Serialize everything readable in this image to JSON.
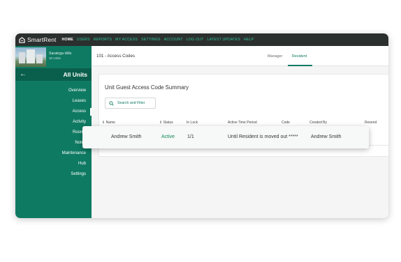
{
  "app": {
    "brand": "SmartRent"
  },
  "topnav": {
    "items": [
      {
        "label": "HOME",
        "active": true
      },
      {
        "label": "USERS"
      },
      {
        "label": "REPORTS"
      },
      {
        "label": "MY ACCESS"
      },
      {
        "label": "SETTINGS"
      },
      {
        "label": "ACCOUNT"
      },
      {
        "label": "LOG OUT"
      },
      {
        "label": "LATEST UPDATES"
      },
      {
        "label": "HELP"
      }
    ]
  },
  "colors": {
    "brand_green": "#0f7a62",
    "nav_active": "#ffffff",
    "nav_link": "#2fc79b",
    "status_active": "#0f8a55"
  },
  "property": {
    "name": "Saratoga Hills",
    "units": "10 Units"
  },
  "sidebar": {
    "title": "All Units",
    "back_icon": "arrow-left-icon",
    "items": [
      {
        "label": "Overview"
      },
      {
        "label": "Leases"
      },
      {
        "label": "Access",
        "active": true
      },
      {
        "label": "Activity"
      },
      {
        "label": "Rooms"
      },
      {
        "label": "Notes"
      },
      {
        "label": "Maintenance"
      },
      {
        "label": "Hub"
      },
      {
        "label": "Settings"
      }
    ]
  },
  "subheader": {
    "unit_title": "101 - Access Codes",
    "tabs": [
      {
        "label": "Manager"
      },
      {
        "label": "Resident",
        "active": true
      }
    ]
  },
  "summary": {
    "title": "Unit Guest Access Code Summary",
    "search_placeholder": "Search and Filter",
    "search_icon": "search-icon",
    "columns": [
      "Name",
      "Status",
      "In Lock",
      "Active Time Period",
      "Code",
      "Created By",
      "Resend"
    ],
    "rows": [
      {
        "name": "Andrew Smith",
        "status": "Active",
        "in_lock": "1/1",
        "active_time_period": "Until Resident is moved out",
        "code": "*****",
        "created_by": "Andrew Smith"
      }
    ]
  }
}
